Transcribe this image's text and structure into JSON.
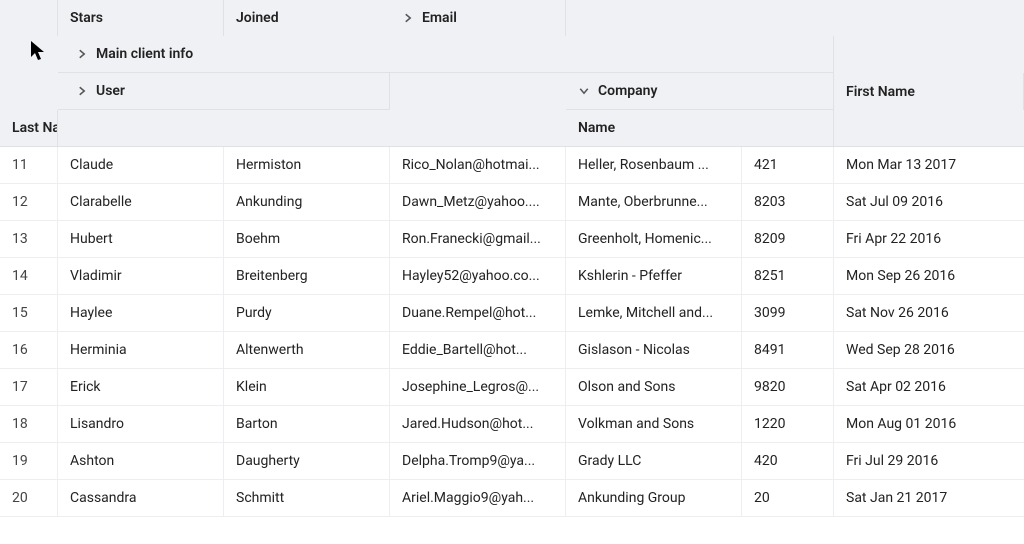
{
  "headers": {
    "group_top": "Main client info",
    "user_group": "User",
    "first_name": "First Name",
    "last_name": "Last Name",
    "email": "Email",
    "company_group": "Company",
    "company_name": "Name",
    "stars": "Stars",
    "joined": "Joined"
  },
  "rows": [
    {
      "idx": "11",
      "first": "Claude",
      "last": "Hermiston",
      "email": "Rico_Nolan@hotmai...",
      "company": "Heller, Rosenbaum ...",
      "stars": "421",
      "joined": "Mon Mar 13 2017"
    },
    {
      "idx": "12",
      "first": "Clarabelle",
      "last": "Ankunding",
      "email": "Dawn_Metz@yahoo....",
      "company": "Mante, Oberbrunne...",
      "stars": "8203",
      "joined": "Sat Jul 09 2016"
    },
    {
      "idx": "13",
      "first": "Hubert",
      "last": "Boehm",
      "email": "Ron.Franecki@gmail...",
      "company": "Greenholt, Homenic...",
      "stars": "8209",
      "joined": "Fri Apr 22 2016"
    },
    {
      "idx": "14",
      "first": "Vladimir",
      "last": "Breitenberg",
      "email": "Hayley52@yahoo.co...",
      "company": "Kshlerin - Pfeffer",
      "stars": "8251",
      "joined": "Mon Sep 26 2016"
    },
    {
      "idx": "15",
      "first": "Haylee",
      "last": "Purdy",
      "email": "Duane.Rempel@hot...",
      "company": "Lemke, Mitchell and...",
      "stars": "3099",
      "joined": "Sat Nov 26 2016"
    },
    {
      "idx": "16",
      "first": "Herminia",
      "last": "Altenwerth",
      "email": "Eddie_Bartell@hot...",
      "company": "Gislason - Nicolas",
      "stars": "8491",
      "joined": "Wed Sep 28 2016"
    },
    {
      "idx": "17",
      "first": "Erick",
      "last": "Klein",
      "email": "Josephine_Legros@...",
      "company": "Olson and Sons",
      "stars": "9820",
      "joined": "Sat Apr 02 2016"
    },
    {
      "idx": "18",
      "first": "Lisandro",
      "last": "Barton",
      "email": "Jared.Hudson@hot...",
      "company": "Volkman and Sons",
      "stars": "1220",
      "joined": "Mon Aug 01 2016"
    },
    {
      "idx": "19",
      "first": "Ashton",
      "last": "Daugherty",
      "email": "Delpha.Tromp9@ya...",
      "company": "Grady LLC",
      "stars": "420",
      "joined": "Fri Jul 29 2016"
    },
    {
      "idx": "20",
      "first": "Cassandra",
      "last": "Schmitt",
      "email": "Ariel.Maggio9@yah...",
      "company": "Ankunding Group",
      "stars": "20",
      "joined": "Sat Jan 21 2017"
    }
  ]
}
